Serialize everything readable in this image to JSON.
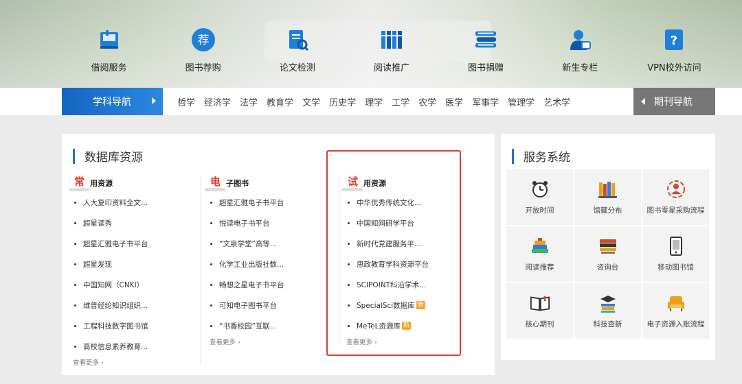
{
  "quick_links": [
    {
      "label": "借阅服务",
      "icon": "book-shelf-icon"
    },
    {
      "label": "图书荐购",
      "icon": "recommend-icon"
    },
    {
      "label": "论文检测",
      "icon": "document-search-icon"
    },
    {
      "label": "阅读推广",
      "icon": "books-icon"
    },
    {
      "label": "图书捐赠",
      "icon": "book-stack-icon"
    },
    {
      "label": "新生专栏",
      "icon": "user-badge-icon"
    },
    {
      "label": "VPN校外访问",
      "icon": "question-icon"
    }
  ],
  "nav": {
    "left_label": "学科导航",
    "subjects": [
      "哲学",
      "经济学",
      "法学",
      "教育学",
      "文学",
      "历史学",
      "理学",
      "工学",
      "农学",
      "医学",
      "军事学",
      "管理学",
      "艺术学"
    ],
    "right_label": "期刊导航"
  },
  "database": {
    "title": "数据库资源",
    "columns": [
      {
        "big": "常",
        "small": "用资源",
        "items": [
          "人大复印资料全文...",
          "超星读秀",
          "超星汇雅电子书平台",
          "超星发现",
          "中国知网（CNKI）",
          "维普经纶知识组织...",
          "工程科技数字图书馆",
          "高校信息素养教育..."
        ],
        "more": "查看更多 ›"
      },
      {
        "big": "电",
        "small": "子图书",
        "items": [
          "超星汇雅电子书平台",
          "悦读电子书平台",
          "“文泉学堂”高等...",
          "化学工业出版社数...",
          "畅想之星电子书平台",
          "可知电子图书平台",
          "“书香校园”互联..."
        ],
        "more": "查看更多 ›"
      },
      {
        "big": "试",
        "small": "用资源",
        "items": [
          "中华优秀传统文化...",
          "中国知网研学平台",
          "新时代党建服务平...",
          "思政教育学科资源平台",
          "SCIPOINT科沿学术...",
          "SpecialSci数据库",
          "MeTeL资源库"
        ],
        "new_badge": "新",
        "more": "查看更多 ›"
      }
    ]
  },
  "services": {
    "title": "服务系统",
    "items": [
      {
        "label": "开放时间",
        "icon": "alarm-clock-icon"
      },
      {
        "label": "馆藏分布",
        "icon": "bookshelf-icon"
      },
      {
        "label": "图书零星采购流程",
        "icon": "cycle-gear-icon"
      },
      {
        "label": "阅读推荐",
        "icon": "book-pile-icon"
      },
      {
        "label": "咨询台",
        "icon": "desk-books-icon"
      },
      {
        "label": "移动图书馆",
        "icon": "mobile-icon"
      },
      {
        "label": "核心期刊",
        "icon": "open-book-icon"
      },
      {
        "label": "科技查新",
        "icon": "graduation-books-icon"
      },
      {
        "label": "电子资源入账流程",
        "icon": "armchair-icon"
      }
    ]
  },
  "colors": {
    "primary_blue": "#1e6fd6",
    "accent_red": "#e23b2a",
    "badge_orange": "#f5a623",
    "grey_nav": "#777777"
  }
}
